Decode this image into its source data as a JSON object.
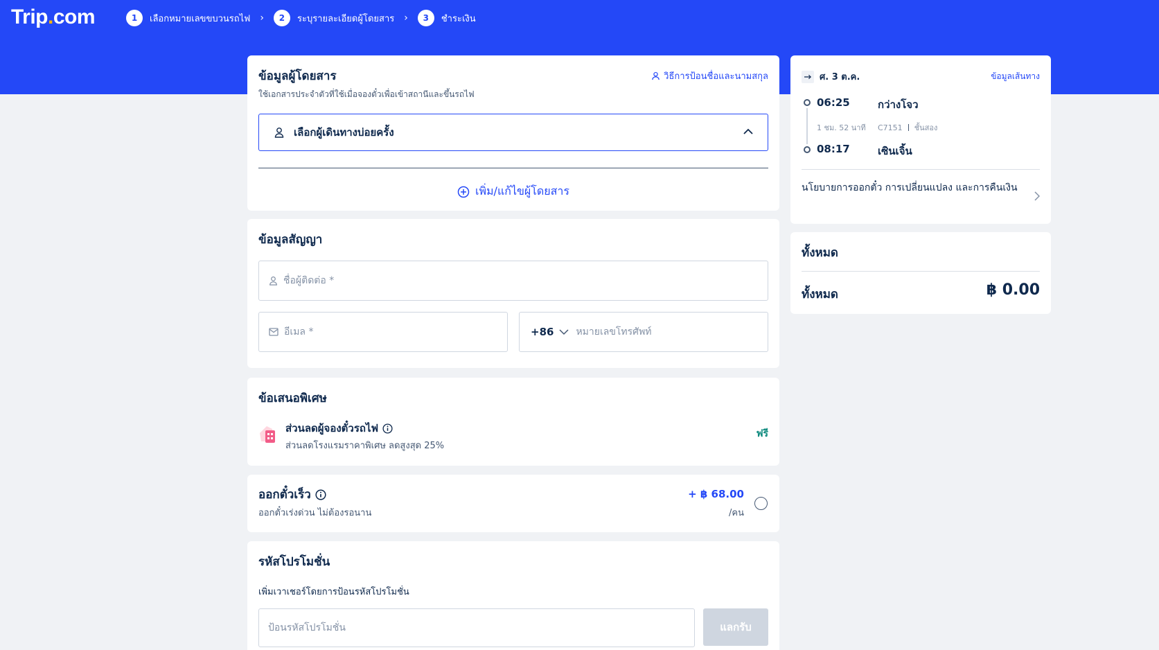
{
  "header": {
    "logo_main": "Trip",
    "logo_dot": ".",
    "logo_end": "com",
    "steps": [
      {
        "num": "1",
        "label": "เลือกหมายเลขขบวนรถไฟ"
      },
      {
        "num": "2",
        "label": "ระบุรายละเอียดผู้โดยสาร"
      },
      {
        "num": "3",
        "label": "ชำระเงิน"
      }
    ]
  },
  "passenger": {
    "title": "ข้อมูลผู้โดยสาร",
    "subtitle": "ใช้เอกสารประจำตัวที่ใช้เมื่อจองตั๋วเพื่อเข้าสถานีและขึ้นรถไฟ",
    "name_help_link": "วิธีการป้อนชื่อและนามสกุล",
    "frequent_select": "เลือกผู้เดินทางบ่อยครั้ง",
    "add_edit": "เพิ่ม/แก้ไขผู้โดยสาร"
  },
  "contact": {
    "title": "ข้อมูลสัญญา",
    "name_placeholder": "ชื่อผู้ติดต่อ *",
    "email_placeholder": "อีเมล *",
    "country_code": "+86",
    "phone_placeholder": "หมายเลขโทรศัพท์"
  },
  "offers": {
    "title": "ข้อเสนอพิเศษ",
    "item_title": "ส่วนลดผู้จองตั๋วรถไฟ",
    "item_desc": "ส่วนลดโรงแรมราคาพิเศษ ลดสูงสุด 25%",
    "item_price": "ฟรี"
  },
  "fast_ticket": {
    "title": "ออกตั๋วเร็ว",
    "desc": "ออกตั๋วเร่งด่วน ไม่ต้องรอนาน",
    "price": "+ ฿ 68.00",
    "unit": "/คน"
  },
  "promo": {
    "title": "รหัสโปรโมชั่น",
    "desc": "เพิ่มเวาเชอร์โดยการป้อนรหัสโปรโมชั่น",
    "placeholder": "ป้อนรหัสโปรโมชั่น",
    "redeem": "แลกรับ"
  },
  "trip": {
    "date": "ศ. 3 ต.ค.",
    "route_info": "ข้อมูลเส้นทาง",
    "dep_time": "06:25",
    "dep_station": "กว่างโจว",
    "duration": "1 ชม. 52 นาที",
    "train_no": "C7151",
    "class": "ชั้นสอง",
    "arr_time": "08:17",
    "arr_station": "เซินเจิ้น",
    "policy": "นโยบายการออกตั๋ว การเปลี่ยนแปลง และการคืนเงิน"
  },
  "summary": {
    "title": "ทั้งหมด",
    "total_label": "ทั้งหมด",
    "total_value": "฿ 0.00"
  },
  "colors": {
    "brand_blue": "#2448f7",
    "free_green": "#0e8a7e"
  }
}
